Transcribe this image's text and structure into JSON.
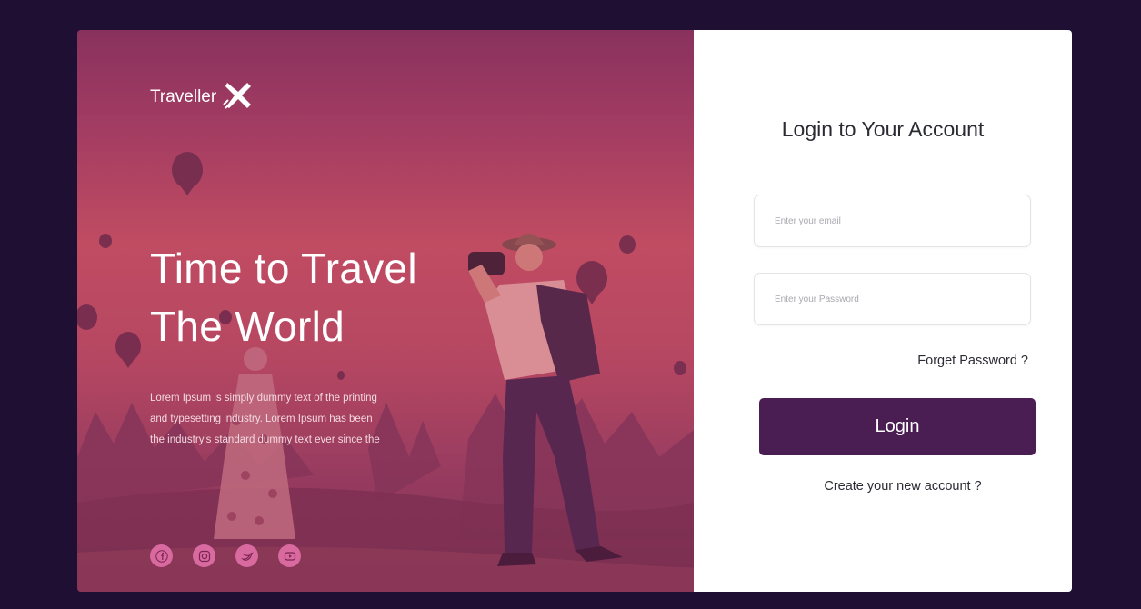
{
  "brand": {
    "name": "Traveller",
    "logo_icon": "airplane-icon"
  },
  "hero": {
    "headline_line1": "Time to Travel",
    "headline_line2": "The World",
    "blurb_line1": "Lorem Ipsum is simply dummy text of the printing",
    "blurb_line2": "and typesetting industry. Lorem Ipsum has been",
    "blurb_line3": "the industry's standard dummy text ever since the",
    "socials": [
      "facebook-icon",
      "instagram-icon",
      "twitter-icon",
      "youtube-icon"
    ]
  },
  "login": {
    "title": "Login to Your Account",
    "email_placeholder": "Enter your email",
    "password_placeholder": "Enter your Password",
    "forget_label": "Forget Password ?",
    "button_label": "Login",
    "create_label": "Create your new account ?"
  },
  "colors": {
    "page_background": "#1f0f33",
    "button": "#4a1d53",
    "hero_tint": "#c65063"
  }
}
